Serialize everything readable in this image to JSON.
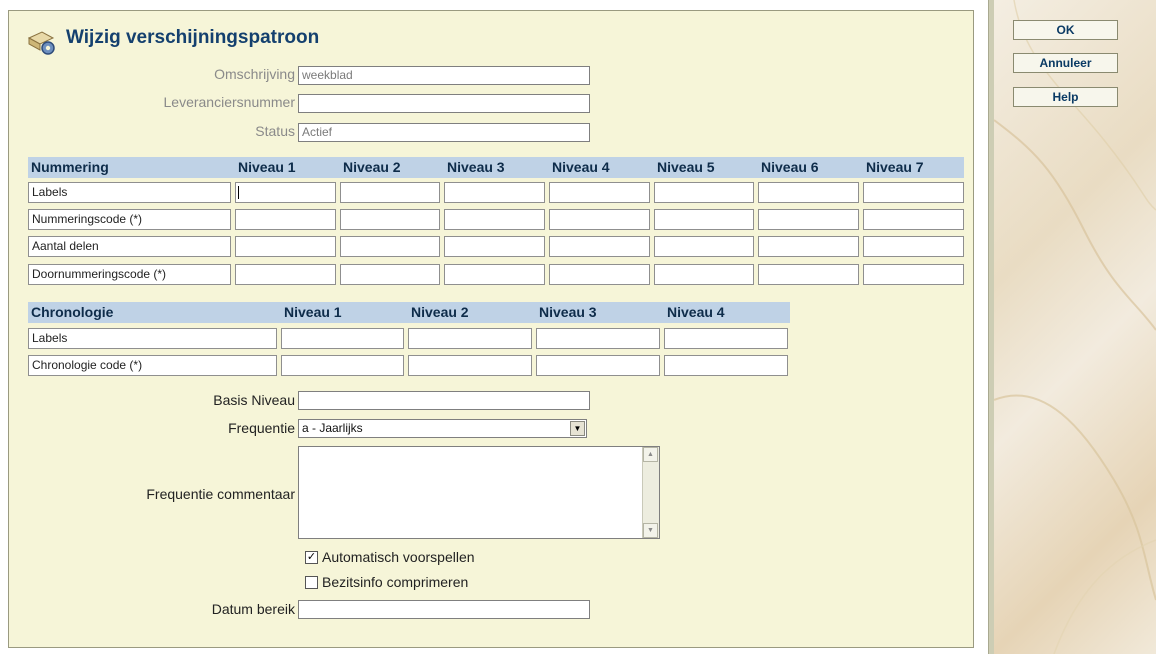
{
  "page_title": "Wijzig verschijningspatroon",
  "buttons": {
    "ok": "OK",
    "cancel": "Annuleer",
    "help": "Help"
  },
  "fields": {
    "omschrijving": {
      "label": "Omschrijving",
      "value": "weekblad"
    },
    "leveranciersnummer": {
      "label": "Leveranciersnummer",
      "value": ""
    },
    "status": {
      "label": "Status",
      "value": "Actief"
    },
    "basis_niveau": {
      "label": "Basis Niveau",
      "value": ""
    },
    "frequentie": {
      "label": "Frequentie",
      "value": "a - Jaarlijks"
    },
    "frequentie_commentaar": {
      "label": "Frequentie commentaar",
      "value": ""
    },
    "datum_bereik": {
      "label": "Datum bereik",
      "value": ""
    }
  },
  "numbering": {
    "header": "Nummering",
    "levels": [
      "Niveau 1",
      "Niveau 2",
      "Niveau 3",
      "Niveau 4",
      "Niveau 5",
      "Niveau 6",
      "Niveau 7"
    ],
    "rows": [
      "Labels",
      "Nummeringscode (*)",
      "Aantal delen",
      "Doornummeringscode (*)"
    ]
  },
  "chronology": {
    "header": "Chronologie",
    "levels": [
      "Niveau 1",
      "Niveau 2",
      "Niveau 3",
      "Niveau 4"
    ],
    "rows": [
      "Labels",
      "Chronologie code (*)"
    ]
  },
  "checkboxes": {
    "auto_predict": {
      "label": "Automatisch voorspellen",
      "checked": true
    },
    "compress": {
      "label": "Bezitsinfo comprimeren",
      "checked": false
    }
  }
}
